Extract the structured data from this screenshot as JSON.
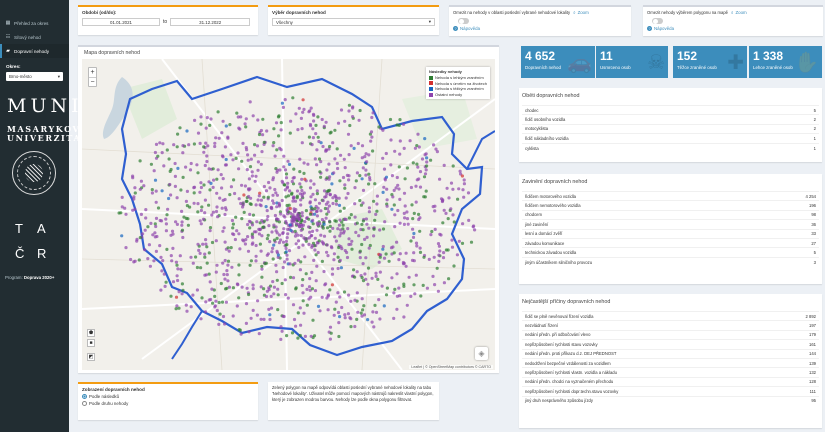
{
  "sidebar": {
    "items": [
      {
        "label": "Přehled za okres",
        "icon": "dashboard-icon"
      },
      {
        "label": "Sítový nehod",
        "icon": "network-icon"
      },
      {
        "label": "Dopravní nehody",
        "icon": "car-icon"
      }
    ],
    "okres_label": "Okres:",
    "okres_value": "Brno-město",
    "muni_top": "MUNI",
    "muni_line1": "MASARYKOVA",
    "muni_line2": "UNIVERZITA",
    "tacr": [
      "T",
      "A",
      "Č",
      "R"
    ],
    "program_prefix": "Program: ",
    "program_name": "Doprava 2020+"
  },
  "period": {
    "label": "Období (od/do):",
    "from": "01.01.2021",
    "sep": "to",
    "to": "31.12.2022"
  },
  "select_accident": {
    "label": "Výběr dopravních nehod",
    "value": "Všechny"
  },
  "option_location": {
    "text": "Omezit na nehody v oblasti poslední vybrané nehodové lokality",
    "zoom": "Zoom",
    "help": "Nápověda"
  },
  "option_polygon": {
    "text": "Omezit nehody výběrem polygonu na mapě",
    "zoom": "Zoom",
    "help": "Nápověda"
  },
  "map": {
    "title": "Mapa dopravních nehod",
    "zoom_in": "+",
    "zoom_out": "−",
    "legend_title": "Následky nehody",
    "legend": [
      {
        "label": "Nehoda s lehkým zraněním",
        "color": "#2e7d32"
      },
      {
        "label": "Nehoda s úmrtím na životech",
        "color": "#d32f2f"
      },
      {
        "label": "Nehoda s těžkým zraněním",
        "color": "#1565c0"
      },
      {
        "label": "Ostatní nehody",
        "color": "#8e44ad"
      }
    ],
    "attribution": "Leaflet | © OpenStreetMap contributors © CARTO"
  },
  "display": {
    "title": "Zobrazení dopravních nehod",
    "options": [
      "Podle následků",
      "Podle druhu nehody"
    ],
    "selected": 0
  },
  "note": "Zelený polygon na mapě odpovídá oblasti poslední vybrané nehodové lokality na tabu 'Nehodové lokality'. Uživatel může pomocí mapových nástrojů nakreslit vlastní polygon, který je zobrazen modrou barvou. Nehody lze podle okna polygonu filtrovat.",
  "stats": [
    {
      "value": "4 652",
      "label": "Dopravních nehod",
      "icon": "car-icon"
    },
    {
      "value": "11",
      "label": "Usmrceno osob",
      "icon": "skull-icon"
    },
    {
      "value": "152",
      "label": "Těžce zraněné osob",
      "icon": "ambulance-icon"
    },
    {
      "value": "1 338",
      "label": "Lehce zraněné osob",
      "icon": "injury-icon"
    }
  ],
  "victims": {
    "title": "Oběti dopravních nehod",
    "rows": [
      [
        "chodec",
        "5"
      ],
      [
        "řidič osobního vozidla",
        "2"
      ],
      [
        "motocyklista",
        "2"
      ],
      [
        "řidič nákladního vozidla",
        "1"
      ],
      [
        "cyklista",
        "1"
      ]
    ]
  },
  "causes": {
    "title": "Zavinění dopravních nehod",
    "rows": [
      [
        "řidičem motorového vozidla",
        "4 254"
      ],
      [
        "řidičem nemotorového vozidla",
        "196"
      ],
      [
        "chodcem",
        "98"
      ],
      [
        "jiné zavinění",
        "36"
      ],
      [
        "lesní a domácí zvěří",
        "33"
      ],
      [
        "závadou komunikace",
        "27"
      ],
      [
        "technickou závadou vozidla",
        "5"
      ],
      [
        "jiným účastníkem silničního provozu",
        "3"
      ]
    ]
  },
  "reasons": {
    "title": "Nejčastější příčiny dopravních nehod",
    "rows": [
      [
        "řidič se plně nevěnoval řízení vozidla",
        "2 892"
      ],
      [
        "nezvládnutí řízení",
        "197"
      ],
      [
        "nedání předn. při odbočování vlevo",
        "179"
      ],
      [
        "nepřizpůsobení rychlosti stavu vozovky",
        "161"
      ],
      [
        "nedání předn. proti příkazu d.z. DEJ PŘEDNOST",
        "144"
      ],
      [
        "nedodržení bezpečné vzdálenosti za vozidlem",
        "139"
      ],
      [
        "nepřizpůsobení rychlosti vlastn. vozidla a nákladu",
        "132"
      ],
      [
        "nedání předn. chodci na vyznačeném přechodu",
        "128"
      ],
      [
        "nepřizpůsobení rychlosti dopr.techn.stavu vozovky",
        "111"
      ],
      [
        "jiný druh nesprávného způsobu jízdy",
        "95"
      ]
    ]
  }
}
